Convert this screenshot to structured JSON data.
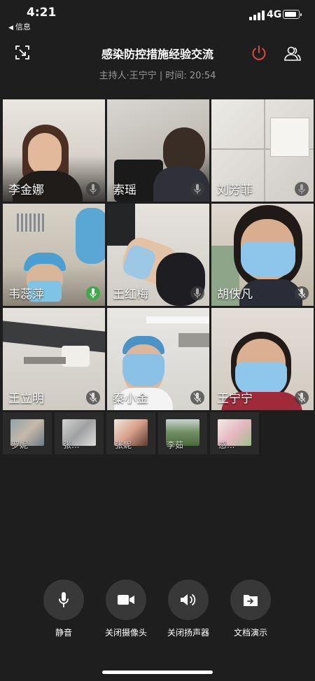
{
  "status_bar": {
    "time": "4:21",
    "back_label": "信息",
    "network": "4G"
  },
  "header": {
    "title": "感染防控措施经验交流",
    "subtitle": "主持人·王宁宁 | 时间: 20:54"
  },
  "participants": [
    {
      "name": "李金娜",
      "mic": "idle"
    },
    {
      "name": "索瑶",
      "mic": "idle"
    },
    {
      "name": "刘芳菲",
      "mic": "idle"
    },
    {
      "name": "韦蕊萍",
      "mic": "speaking"
    },
    {
      "name": "王红梅",
      "mic": "idle"
    },
    {
      "name": "胡佚凡",
      "mic": "muted"
    },
    {
      "name": "王立明",
      "mic": "muted"
    },
    {
      "name": "秦小金",
      "mic": "muted"
    },
    {
      "name": "王宁宁",
      "mic": "muted"
    }
  ],
  "thumbnails": [
    {
      "name": "罗妮"
    },
    {
      "name": "张..."
    },
    {
      "name": "张妮"
    },
    {
      "name": "李茹"
    },
    {
      "name": "感..."
    }
  ],
  "controls": {
    "mute": "静音",
    "camera": "关闭摄像头",
    "speaker": "关闭扬声器",
    "share": "文档演示"
  },
  "colors": {
    "background": "#1e1e1e",
    "leave_red": "#e2463a",
    "speaking_green": "#3fa84a"
  },
  "icons": [
    "minimize-icon",
    "power-icon",
    "participants-icon",
    "microphone-icon",
    "camera-icon",
    "speaker-icon",
    "share-document-icon"
  ]
}
